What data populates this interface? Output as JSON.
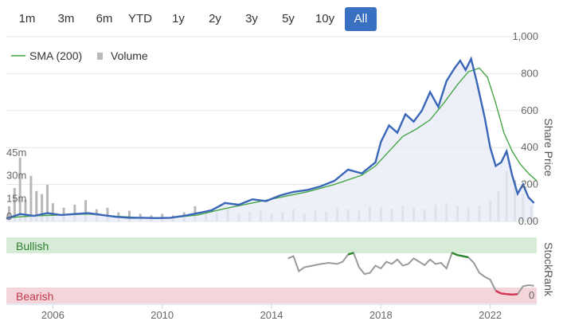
{
  "range_buttons": [
    {
      "label": "1m",
      "active": false
    },
    {
      "label": "3m",
      "active": false
    },
    {
      "label": "6m",
      "active": false
    },
    {
      "label": "YTD",
      "active": false
    },
    {
      "label": "1y",
      "active": false
    },
    {
      "label": "2y",
      "active": false
    },
    {
      "label": "3y",
      "active": false
    },
    {
      "label": "5y",
      "active": false
    },
    {
      "label": "10y",
      "active": false
    },
    {
      "label": "All",
      "active": true
    }
  ],
  "chart_data": [
    {
      "type": "line",
      "ylabel": "Share Price",
      "ylim": [
        0,
        1000
      ],
      "y_ticks": [
        "1,000",
        "800",
        "600",
        "400",
        "200",
        "0.00"
      ],
      "x_ticks": [
        "2006",
        "2010",
        "2014",
        "2018",
        "2022"
      ],
      "xlim": [
        2004.3,
        2023.7
      ],
      "legend": [
        "SMA (200)",
        "Volume"
      ],
      "legend_position": "top-left",
      "grid": true,
      "colors": {
        "price": "#3a66b8",
        "sma": "#46a646",
        "volume": "#b8b8b8"
      },
      "series": [
        {
          "name": "",
          "role": "price",
          "x": [
            2004.3,
            2004.8,
            2005.3,
            2005.8,
            2006.3,
            2006.8,
            2007.3,
            2007.8,
            2008.3,
            2008.8,
            2009.3,
            2009.8,
            2010.3,
            2010.8,
            2011.3,
            2011.8,
            2012.3,
            2012.8,
            2013.3,
            2013.8,
            2014.3,
            2014.8,
            2015.3,
            2015.8,
            2016.3,
            2016.8,
            2017.3,
            2017.8,
            2018.0,
            2018.3,
            2018.6,
            2018.9,
            2019.2,
            2019.5,
            2019.8,
            2020.1,
            2020.4,
            2020.7,
            2020.9,
            2021.1,
            2021.3,
            2021.5,
            2021.8,
            2022.0,
            2022.2,
            2022.4,
            2022.6,
            2022.8,
            2023.0,
            2023.2,
            2023.4,
            2023.6
          ],
          "y": [
            15,
            40,
            30,
            45,
            35,
            40,
            45,
            35,
            25,
            20,
            20,
            18,
            20,
            30,
            45,
            60,
            100,
            90,
            120,
            110,
            140,
            160,
            170,
            190,
            220,
            280,
            260,
            320,
            430,
            520,
            480,
            580,
            540,
            600,
            700,
            620,
            760,
            830,
            870,
            820,
            880,
            760,
            560,
            400,
            300,
            320,
            380,
            250,
            150,
            200,
            130,
            100
          ]
        },
        {
          "name": "SMA (200)",
          "role": "sma",
          "x": [
            2004.3,
            2005.3,
            2006.3,
            2007.3,
            2008.3,
            2009.3,
            2010.3,
            2011.3,
            2012.3,
            2013.3,
            2014.3,
            2015.3,
            2016.3,
            2017.3,
            2017.8,
            2018.3,
            2018.8,
            2019.3,
            2019.8,
            2020.3,
            2020.8,
            2021.2,
            2021.6,
            2021.9,
            2022.2,
            2022.5,
            2022.8,
            2023.1,
            2023.4,
            2023.7
          ],
          "y": [
            20,
            30,
            35,
            40,
            28,
            20,
            20,
            35,
            70,
            100,
            130,
            160,
            200,
            250,
            300,
            380,
            460,
            500,
            550,
            640,
            740,
            810,
            830,
            780,
            640,
            480,
            380,
            310,
            260,
            220
          ]
        },
        {
          "name": "Volume",
          "role": "volume",
          "unit": "m",
          "ticks": [
            "0",
            "15m",
            "30m",
            "45m"
          ],
          "x": [
            2004.4,
            2004.6,
            2004.8,
            2005.0,
            2005.2,
            2005.4,
            2005.6,
            2005.8,
            2006.0,
            2006.4,
            2006.8,
            2007.2,
            2007.6,
            2008.0,
            2008.4,
            2008.8,
            2009.2,
            2009.6,
            2010.0,
            2010.4,
            2010.8,
            2011.2,
            2011.6,
            2012.0,
            2012.4,
            2012.8,
            2013.2,
            2013.6,
            2014.0,
            2014.4,
            2014.8,
            2015.2,
            2015.6,
            2016.0,
            2016.4,
            2016.8,
            2017.2,
            2017.6,
            2018.0,
            2018.4,
            2018.8,
            2019.2,
            2019.6,
            2020.0,
            2020.4,
            2020.8,
            2021.2,
            2021.6,
            2022.0,
            2022.3,
            2022.6,
            2022.9,
            2023.2,
            2023.5
          ],
          "y": [
            10,
            22,
            42,
            14,
            30,
            20,
            18,
            24,
            12,
            9,
            11,
            14,
            8,
            9,
            6,
            7,
            5,
            4,
            5,
            4,
            6,
            10,
            7,
            6,
            8,
            5,
            6,
            7,
            5,
            6,
            8,
            5,
            7,
            6,
            9,
            8,
            7,
            10,
            9,
            8,
            10,
            9,
            8,
            11,
            12,
            10,
            9,
            10,
            14,
            20,
            33,
            27,
            18,
            10
          ]
        }
      ]
    },
    {
      "type": "line",
      "ylabel": "StockRank",
      "ylim": [
        0,
        100
      ],
      "zones": [
        {
          "label": "Bullish",
          "color": "#d6ecd6",
          "text_color": "#2f7d2f"
        },
        {
          "label": "Bearish",
          "color": "#f4d6da",
          "text_color": "#c0394c"
        }
      ],
      "y_ticks": [
        "0"
      ],
      "x_ticks": [
        "2006",
        "2010",
        "2014",
        "2018",
        "2022"
      ],
      "series": [
        {
          "name": "StockRank",
          "x": [
            2014.6,
            2014.8,
            2015.0,
            2015.2,
            2015.5,
            2015.8,
            2016.1,
            2016.4,
            2016.6,
            2016.8,
            2017.0,
            2017.2,
            2017.4,
            2017.6,
            2017.8,
            2018.0,
            2018.2,
            2018.4,
            2018.6,
            2018.8,
            2019.0,
            2019.2,
            2019.4,
            2019.6,
            2019.8,
            2020.0,
            2020.2,
            2020.4,
            2020.6,
            2020.8,
            2021.0,
            2021.2,
            2021.4,
            2021.6,
            2021.8,
            2022.0,
            2022.2,
            2022.4,
            2022.6,
            2022.8,
            2023.0,
            2023.2,
            2023.4,
            2023.6
          ],
          "y": [
            68,
            72,
            45,
            52,
            55,
            58,
            60,
            58,
            62,
            75,
            78,
            52,
            40,
            42,
            55,
            50,
            62,
            58,
            66,
            55,
            58,
            68,
            62,
            56,
            66,
            58,
            60,
            50,
            78,
            74,
            72,
            70,
            60,
            42,
            35,
            30,
            10,
            5,
            4,
            3,
            4,
            18,
            20,
            19
          ],
          "bullish_above": 70,
          "bearish_below": 12
        }
      ]
    }
  ]
}
